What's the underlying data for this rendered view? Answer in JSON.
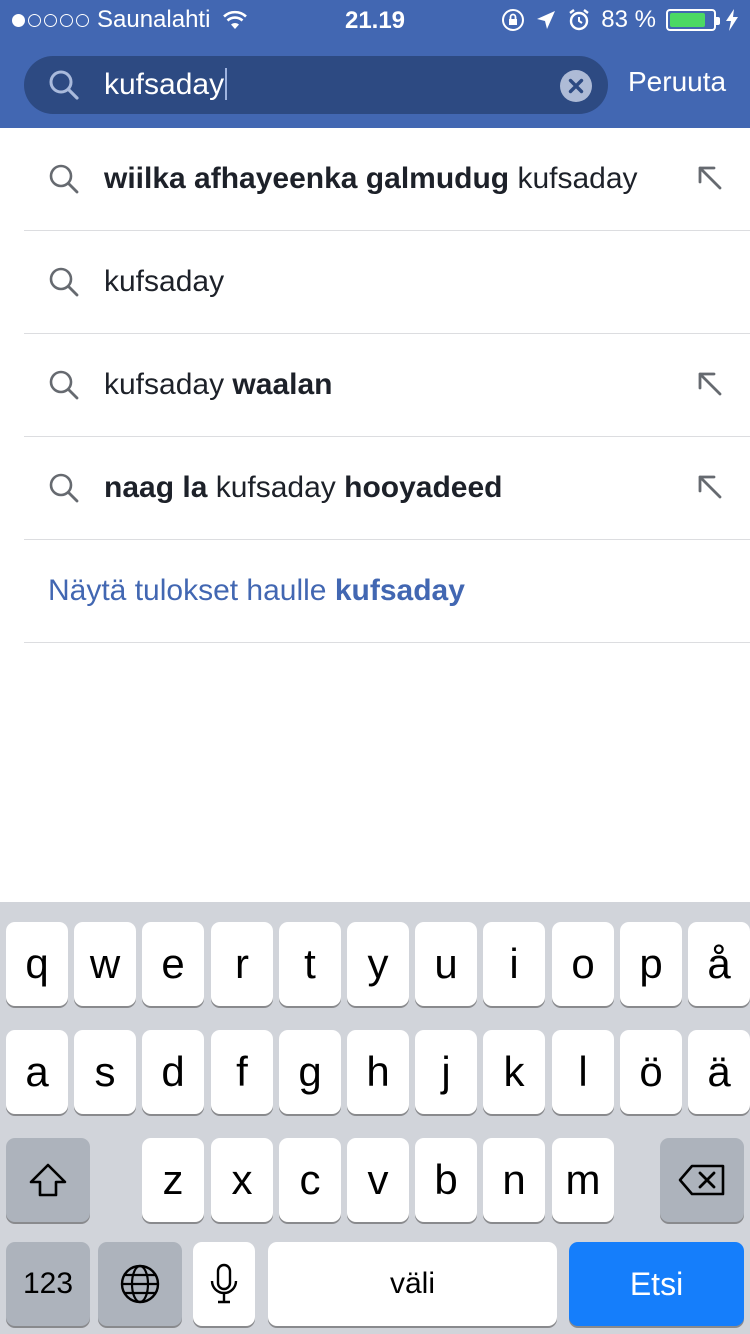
{
  "status_bar": {
    "carrier": "Saunalahti",
    "signal_bars_filled": 1,
    "signal_bars_total": 5,
    "time": "21.19",
    "battery_percent": "83 %",
    "battery_level": 0.83
  },
  "search": {
    "value": "kufsaday",
    "cancel_label": "Peruuta"
  },
  "suggestions": [
    {
      "parts": [
        {
          "text": "wiilka afhayeenka galmudug",
          "bold": true
        },
        {
          "text": " kufsaday",
          "bold": false
        }
      ],
      "has_arrow": true
    },
    {
      "parts": [
        {
          "text": "kufsaday",
          "bold": false
        }
      ],
      "has_arrow": false
    },
    {
      "parts": [
        {
          "text": "kufsaday ",
          "bold": false
        },
        {
          "text": "waalan",
          "bold": true
        }
      ],
      "has_arrow": true
    },
    {
      "parts": [
        {
          "text": "naag la ",
          "bold": true
        },
        {
          "text": "kufsaday ",
          "bold": false
        },
        {
          "text": "hooyadeed",
          "bold": true
        }
      ],
      "has_arrow": true
    }
  ],
  "show_results": {
    "prefix": "Näytä tulokset haulle ",
    "query": "kufsaday"
  },
  "keyboard": {
    "row1": [
      "q",
      "w",
      "e",
      "r",
      "t",
      "y",
      "u",
      "i",
      "o",
      "p",
      "å"
    ],
    "row2": [
      "a",
      "s",
      "d",
      "f",
      "g",
      "h",
      "j",
      "k",
      "l",
      "ö",
      "ä"
    ],
    "row3": [
      "z",
      "x",
      "c",
      "v",
      "b",
      "n",
      "m"
    ],
    "numbers_label": "123",
    "space_label": "väli",
    "search_label": "Etsi"
  },
  "colors": {
    "header": "#4267b2",
    "search_field": "#2d4a82",
    "link": "#4267b2",
    "keyboard_bg": "#d1d4da",
    "search_key": "#157efb",
    "battery_fill": "#4cd964"
  }
}
